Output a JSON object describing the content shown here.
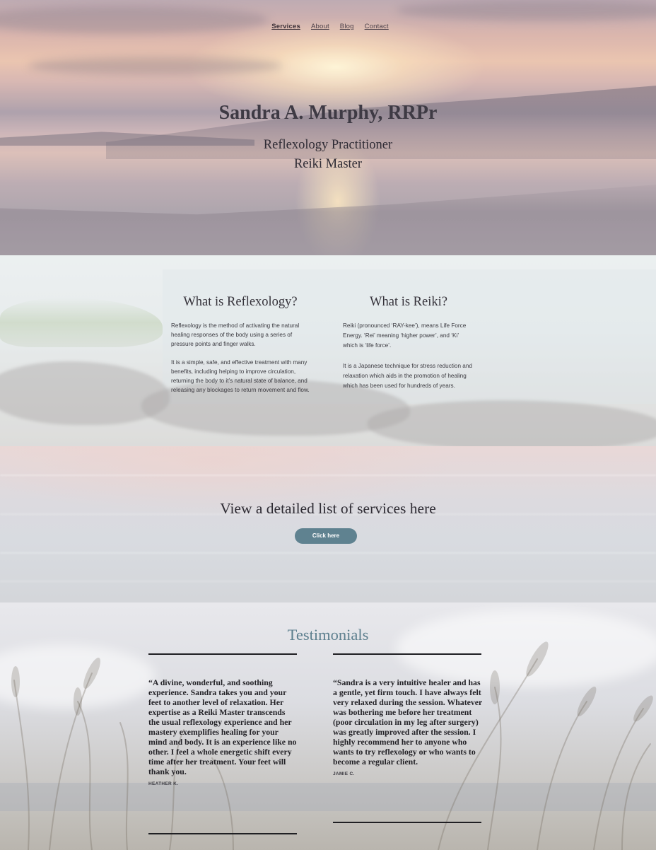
{
  "nav": {
    "items": [
      {
        "label": "Services",
        "active": true
      },
      {
        "label": "About",
        "active": false
      },
      {
        "label": "Blog",
        "active": false
      },
      {
        "label": "Contact",
        "active": false
      }
    ]
  },
  "hero": {
    "title": "Sandra A. Murphy, RRPr",
    "subtitle_line1": "Reflexology Practitioner",
    "subtitle_line2": "Reiki Master"
  },
  "info": {
    "reflexology": {
      "heading": "What is Reflexology?",
      "paragraph1": "Reflexology is the method of activating the natural healing responses of the body using a series of pressure points and finger walks.",
      "paragraph2": "It is a simple, safe, and effective treatment with many benefits, including helping to improve circulation, returning the body to it’s natural state of balance, and releasing any blockages to return movement and flow."
    },
    "reiki": {
      "heading": "What is Reiki?",
      "paragraph1": "Reiki (pronounced ‘RAY-kee’), means Life Force Energy. ‘Rei’ meaning ‘higher power’, and ‘Ki’ which is ‘life force’.",
      "paragraph2": "It is a Japanese technique for stress reduction and relaxation which aids in the promotion of healing which has been used for hundreds of years."
    }
  },
  "cta": {
    "heading": "View a detailed list of services here",
    "button_label": "Click here",
    "button_color": "#5f8290"
  },
  "testimonials": {
    "heading": "Testimonials",
    "heading_color": "#5d7f8e",
    "items": [
      {
        "quote": "“A divine, wonderful, and soothing experience. Sandra takes you and your feet to another level of relaxation. Her expertise as a Reiki Master transcends the usual reflexology experience and her mastery exemplifies healing for your mind and body. It is an experience like no other. I feel a whole energetic shift every time after her treatment. Your feet will thank you.",
        "author": "HEATHER K."
      },
      {
        "quote": "“Sandra is a very intuitive healer and has a gentle, yet firm touch. I have always felt very relaxed during the session. Whatever was bothering me before her treatment (poor circulation in my leg after surgery) was greatly improved after the session. I highly recommend her to anyone who wants to try reflexology or who wants to become a regular client.",
        "author": "JAMIE C."
      }
    ]
  }
}
